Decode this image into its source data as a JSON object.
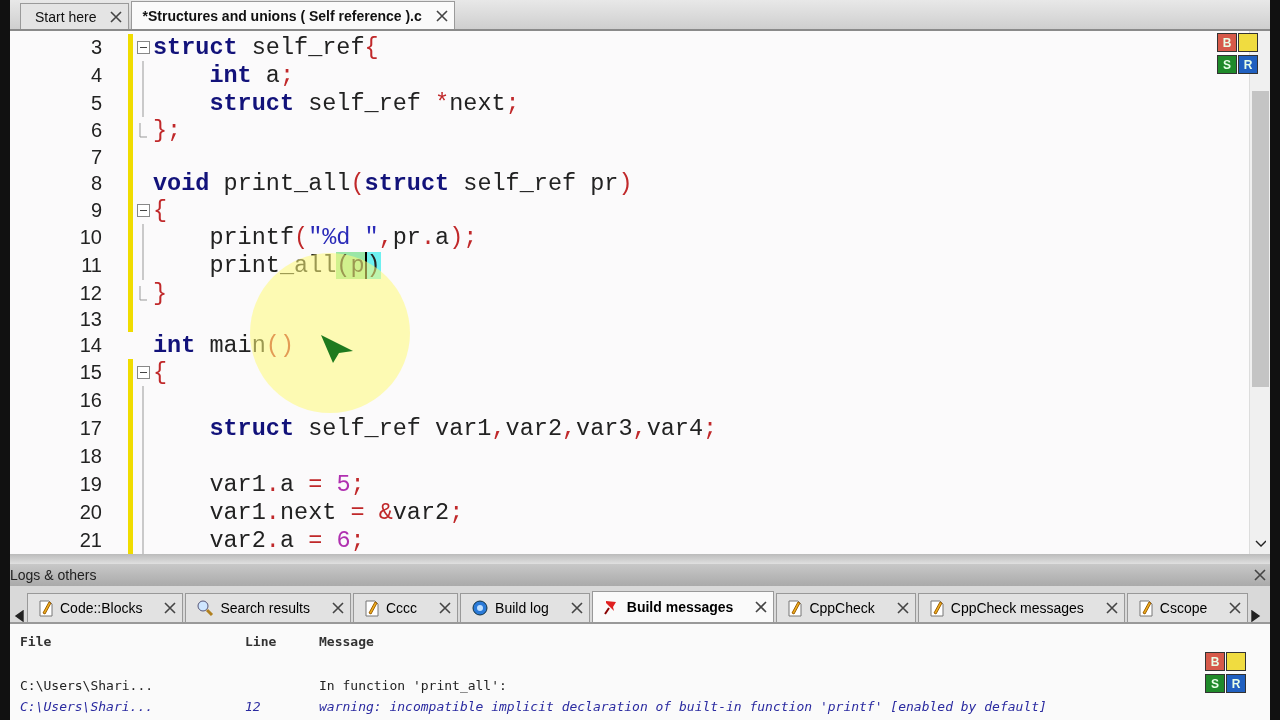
{
  "editor_tabs": [
    {
      "label": "Start here",
      "selected": false
    },
    {
      "label": "*Structures and unions ( Self reference ).c",
      "selected": true
    }
  ],
  "code_lines": [
    {
      "number": "3",
      "changed": true,
      "kind": "fold_start",
      "tokens": [
        {
          "kind": "keyword",
          "text": "struct"
        },
        {
          "kind": "plain",
          "text": " self_ref"
        },
        {
          "kind": "punct",
          "text": "{"
        }
      ]
    },
    {
      "number": "4",
      "changed": true,
      "kind": "fold_body",
      "tokens": [
        {
          "kind": "keyword",
          "text": "    int"
        },
        {
          "kind": "plain",
          "text": " a"
        },
        {
          "kind": "punct",
          "text": ";"
        }
      ]
    },
    {
      "number": "5",
      "changed": true,
      "kind": "fold_body",
      "tokens": [
        {
          "kind": "keyword",
          "text": "    struct"
        },
        {
          "kind": "plain",
          "text": " self_ref "
        },
        {
          "kind": "punct",
          "text": "*"
        },
        {
          "kind": "plain",
          "text": "next"
        },
        {
          "kind": "punct",
          "text": ";"
        }
      ]
    },
    {
      "number": "6",
      "changed": true,
      "kind": "fold_end",
      "tokens": [
        {
          "kind": "punct",
          "text": "};"
        }
      ]
    },
    {
      "number": "7",
      "changed": true,
      "kind": "plain"
    },
    {
      "number": "8",
      "changed": true,
      "kind": "plain",
      "tokens": [
        {
          "kind": "keyword",
          "text": "void"
        },
        {
          "kind": "plain",
          "text": " print_all"
        },
        {
          "kind": "punct",
          "text": "("
        },
        {
          "kind": "keyword",
          "text": "struct"
        },
        {
          "kind": "plain",
          "text": " self_ref pr"
        },
        {
          "kind": "punct",
          "text": ")"
        }
      ]
    },
    {
      "number": "9",
      "changed": true,
      "kind": "fold_start",
      "tokens": [
        {
          "kind": "punct",
          "text": "{"
        }
      ]
    },
    {
      "number": "10",
      "changed": true,
      "kind": "fold_body",
      "tokens": [
        {
          "kind": "plain",
          "text": "    printf"
        },
        {
          "kind": "punct",
          "text": "("
        },
        {
          "kind": "string",
          "text": "\"%d \""
        },
        {
          "kind": "punct",
          "text": ","
        },
        {
          "kind": "plain",
          "text": "pr"
        },
        {
          "kind": "punct",
          "text": "."
        },
        {
          "kind": "plain",
          "text": "a"
        },
        {
          "kind": "punct",
          "text": ");"
        }
      ]
    },
    {
      "number": "11",
      "changed": true,
      "kind": "fold_body",
      "tokens": [
        {
          "kind": "plain",
          "text": "    print_all"
        },
        {
          "kind": "brace_match",
          "text": "(p"
        },
        {
          "kind": "cursor",
          "text": ")"
        }
      ]
    },
    {
      "number": "12",
      "changed": true,
      "kind": "fold_end",
      "tokens": [
        {
          "kind": "punct",
          "text": "}"
        }
      ]
    },
    {
      "number": "13",
      "changed": true,
      "kind": "plain"
    },
    {
      "number": "14",
      "changed": false,
      "kind": "plain",
      "tokens": [
        {
          "kind": "keyword",
          "text": "int"
        },
        {
          "kind": "plain",
          "text": " main"
        },
        {
          "kind": "punct",
          "text": "()"
        }
      ]
    },
    {
      "number": "15",
      "changed": true,
      "kind": "fold_start",
      "tokens": [
        {
          "kind": "punct",
          "text": "{"
        }
      ]
    },
    {
      "number": "16",
      "changed": true,
      "kind": "fold_body"
    },
    {
      "number": "17",
      "changed": true,
      "kind": "fold_body",
      "tokens": [
        {
          "kind": "keyword",
          "text": "    struct"
        },
        {
          "kind": "plain",
          "text": " self_ref var1"
        },
        {
          "kind": "punct",
          "text": ","
        },
        {
          "kind": "plain",
          "text": "var2"
        },
        {
          "kind": "punct",
          "text": ","
        },
        {
          "kind": "plain",
          "text": "var3"
        },
        {
          "kind": "punct",
          "text": ","
        },
        {
          "kind": "plain",
          "text": "var4"
        },
        {
          "kind": "punct",
          "text": ";"
        }
      ]
    },
    {
      "number": "18",
      "changed": true,
      "kind": "fold_body"
    },
    {
      "number": "19",
      "changed": true,
      "kind": "fold_body",
      "tokens": [
        {
          "kind": "plain",
          "text": "    var1"
        },
        {
          "kind": "punct",
          "text": "."
        },
        {
          "kind": "plain",
          "text": "a "
        },
        {
          "kind": "punct",
          "text": "= "
        },
        {
          "kind": "number",
          "text": "5"
        },
        {
          "kind": "punct",
          "text": ";"
        }
      ]
    },
    {
      "number": "20",
      "changed": true,
      "kind": "fold_body",
      "tokens": [
        {
          "kind": "plain",
          "text": "    var1"
        },
        {
          "kind": "punct",
          "text": "."
        },
        {
          "kind": "plain",
          "text": "next "
        },
        {
          "kind": "punct",
          "text": "= &"
        },
        {
          "kind": "plain",
          "text": "var2"
        },
        {
          "kind": "punct",
          "text": ";"
        }
      ]
    },
    {
      "number": "21",
      "changed": true,
      "kind": "fold_body",
      "tokens": [
        {
          "kind": "plain",
          "text": "    var2"
        },
        {
          "kind": "punct",
          "text": "."
        },
        {
          "kind": "plain",
          "text": "a "
        },
        {
          "kind": "punct",
          "text": "= "
        },
        {
          "kind": "number",
          "text": "6"
        },
        {
          "kind": "punct",
          "text": ";"
        }
      ]
    }
  ],
  "recorder_widgets": [
    {
      "buttons": [
        "B",
        "S",
        "R"
      ]
    },
    {
      "buttons": [
        "B",
        "S",
        "R"
      ]
    }
  ],
  "logs_panel": {
    "title": "Logs & others",
    "tabs": [
      {
        "label": "Code::Blocks",
        "kind": "doc",
        "selected": false
      },
      {
        "label": "Search results",
        "kind": "search",
        "selected": false
      },
      {
        "label": "Cccc",
        "kind": "doc",
        "selected": false
      },
      {
        "label": "Build log",
        "kind": "gear",
        "selected": false
      },
      {
        "label": "Build messages",
        "kind": "pin",
        "selected": true
      },
      {
        "label": "CppCheck",
        "kind": "doc",
        "selected": false
      },
      {
        "label": "CppCheck messages",
        "kind": "doc",
        "selected": false
      },
      {
        "label": "Cscope",
        "kind": "doc",
        "selected": false
      }
    ],
    "columns": [
      "File",
      "Line",
      "Message"
    ],
    "rows": [
      {
        "kind": "info",
        "file": "C:\\Users\\Shari...",
        "message": "In function 'print_all':"
      },
      {
        "kind": "warning",
        "file": "C:\\Users\\Shari...",
        "line": "12",
        "message": "warning: incompatible implicit declaration of built-in function 'printf' [enabled by default]"
      }
    ]
  }
}
